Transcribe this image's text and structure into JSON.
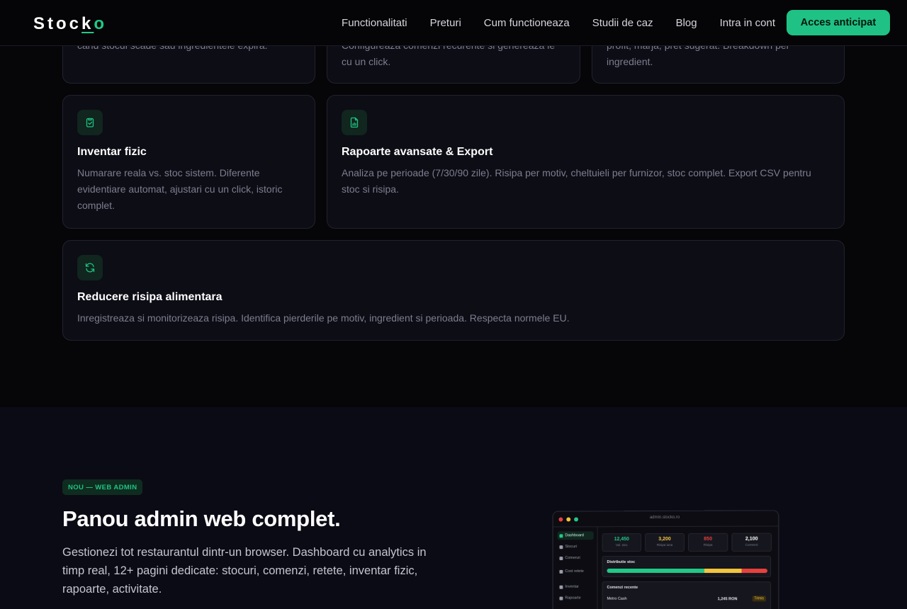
{
  "nav": {
    "logo_pre": "Stoc",
    "logo_k": "k",
    "logo_o": "o",
    "links": [
      "Functionalitati",
      "Preturi",
      "Cum functioneaza",
      "Studii de caz",
      "Blog",
      "Intra in cont"
    ],
    "cta": "Acces anticipat"
  },
  "features": {
    "partial": [
      "cand stocul scade sau ingredientele expira.",
      "Configureaza comenzi recurente si genereaza le cu un click.",
      "profit, marja, pret sugerat. Breakdown per ingredient."
    ],
    "cards": [
      {
        "icon": "clipboard-check-icon",
        "title": "Inventar fizic",
        "desc": "Numarare reala vs. stoc sistem. Diferente evidentiare automat, ajustari cu un click, istoric complet."
      },
      {
        "icon": "file-chart-icon",
        "title": "Rapoarte avansate & Export",
        "desc": "Analiza pe perioade (7/30/90 zile). Risipa per motiv, cheltuieli per furnizor, stoc complet. Export CSV pentru stoc si risipa."
      },
      {
        "icon": "refresh-icon",
        "title": "Reducere risipa alimentara",
        "desc": "Inregistreaza si monitorizeaza risipa. Identifica pierderile pe motiv, ingredient si perioada. Respecta normele EU."
      }
    ],
    "accent": "#1fc284"
  },
  "admin": {
    "badge": "NOU — WEB ADMIN",
    "title": "Panou admin web complet.",
    "lead": "Gestionezi tot restaurantul dintr-un browser. Dashboard cu analytics in timp real, 12+ pagini dedicate: stocuri, comenzi, retete, inventar fizic, rapoarte, activitate."
  },
  "mock": {
    "url": "admin.stocko.ro",
    "sidebar": [
      "Dashboard",
      "Stocuri",
      "Comenzi",
      "Cost retete",
      "Inventar",
      "Rapoarte"
    ],
    "stats": [
      {
        "value": "12,450",
        "label": "Val. stoc",
        "color": "#22c986"
      },
      {
        "value": "3,200",
        "label": "Risipa luna",
        "color": "#f2c53d"
      },
      {
        "value": "850",
        "label": "Risipa",
        "color": "#e8413c"
      },
      {
        "value": "2,100",
        "label": "Comenzi",
        "color": "#ffffff"
      }
    ],
    "distribution_title": "Distributie stoc",
    "orders_title": "Comenzi recente",
    "order_supplier": "Metro Cash",
    "order_amount": "1,245 RON",
    "order_status": "Trimis"
  }
}
